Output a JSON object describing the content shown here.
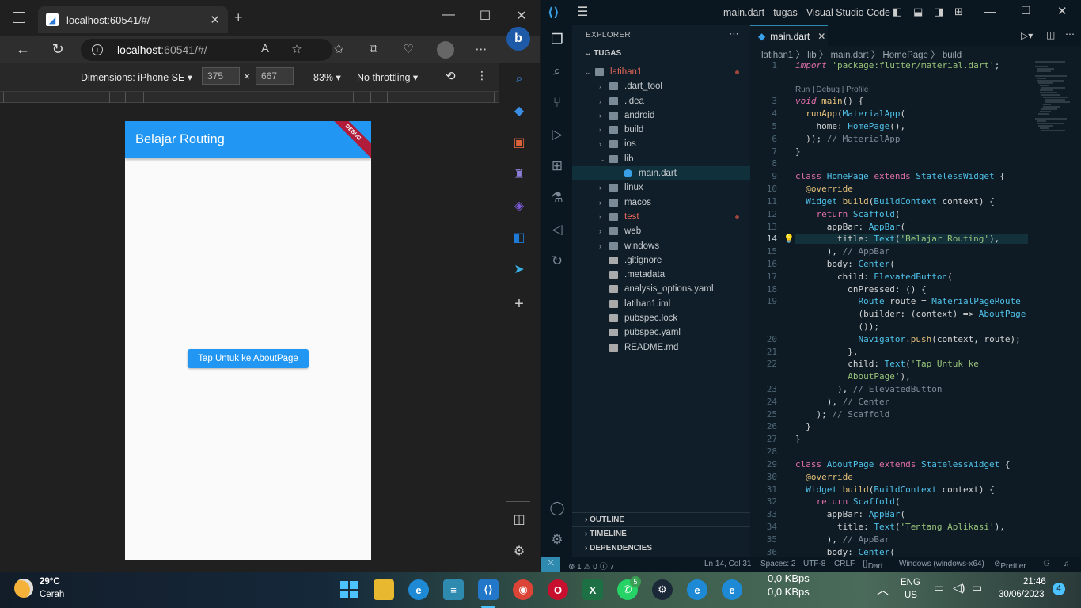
{
  "edge": {
    "tab_title": "localhost:60541/#/",
    "url_host": "localhost",
    "url_path": ":60541/#/",
    "devtools": {
      "dimensions": "Dimensions: iPhone SE",
      "width": "375",
      "height": "667",
      "times": "×",
      "zoom": "83%",
      "throttling": "No throttling"
    },
    "app": {
      "appbar_title": "Belajar Routing",
      "debug_banner": "DEBUG",
      "button_label": "Tap Untuk ke AboutPage"
    }
  },
  "vscode": {
    "title": "main.dart - tugas - Visual Studio Code",
    "explorer_header": "EXPLORER",
    "workspace": "TUGAS",
    "tree": [
      {
        "name": "latihan1",
        "indent": 0,
        "type": "folder-open",
        "color": "#e8685a"
      },
      {
        "name": ".dart_tool",
        "indent": 1,
        "type": "folder"
      },
      {
        "name": ".idea",
        "indent": 1,
        "type": "folder"
      },
      {
        "name": "android",
        "indent": 1,
        "type": "folder"
      },
      {
        "name": "build",
        "indent": 1,
        "type": "folder"
      },
      {
        "name": "ios",
        "indent": 1,
        "type": "folder"
      },
      {
        "name": "lib",
        "indent": 1,
        "type": "folder-open"
      },
      {
        "name": "main.dart",
        "indent": 2,
        "type": "dart",
        "selected": true
      },
      {
        "name": "linux",
        "indent": 1,
        "type": "folder"
      },
      {
        "name": "macos",
        "indent": 1,
        "type": "folder"
      },
      {
        "name": "test",
        "indent": 1,
        "type": "folder",
        "color": "#e8685a"
      },
      {
        "name": "web",
        "indent": 1,
        "type": "folder"
      },
      {
        "name": "windows",
        "indent": 1,
        "type": "folder"
      },
      {
        "name": ".gitignore",
        "indent": 1,
        "type": "file"
      },
      {
        "name": ".metadata",
        "indent": 1,
        "type": "file"
      },
      {
        "name": "analysis_options.yaml",
        "indent": 1,
        "type": "file"
      },
      {
        "name": "latihan1.iml",
        "indent": 1,
        "type": "file"
      },
      {
        "name": "pubspec.lock",
        "indent": 1,
        "type": "file"
      },
      {
        "name": "pubspec.yaml",
        "indent": 1,
        "type": "file"
      },
      {
        "name": "README.md",
        "indent": 1,
        "type": "file"
      }
    ],
    "sections": [
      "OUTLINE",
      "TIMELINE",
      "DEPENDENCIES"
    ],
    "tab": "main.dart",
    "breadcrumb": "latihan1 〉 lib 〉 main.dart 〉 HomePage 〉 build",
    "codelens": "Run | Debug | Profile",
    "status": {
      "errors": "⊗ 1 ⚠ 0 ⓘ 7",
      "position": "Ln 14, Col 31",
      "spaces": "Spaces: 2",
      "encoding": "UTF-8",
      "eol": "CRLF",
      "language": "Dart",
      "device": "Windows (windows-x64)",
      "formatter": "Prettier"
    }
  },
  "taskbar": {
    "temp": "29°C",
    "weather": "Cerah",
    "net_up": "0,0 KBps",
    "net_down": "0,0 KBps",
    "lang": "ENG",
    "region": "US",
    "time": "21:46",
    "date": "30/06/2023",
    "whatsapp_badge": "5",
    "notif_count": "4"
  }
}
